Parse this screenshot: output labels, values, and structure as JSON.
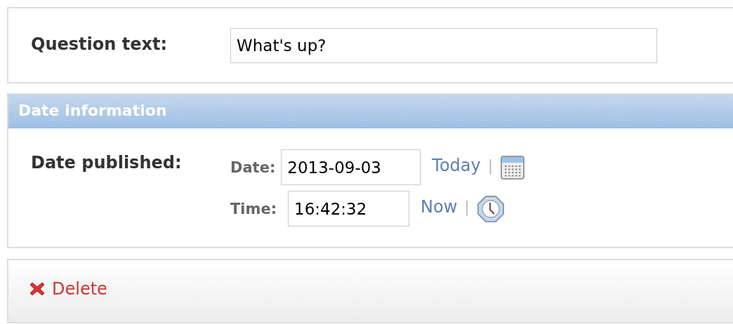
{
  "question": {
    "label": "Question text:",
    "value": "What's up?"
  },
  "date_section": {
    "title": "Date information",
    "label": "Date published:",
    "rows": [
      {
        "kind": "date",
        "label": "Date:",
        "value": "2013-09-03",
        "shortcut": "Today",
        "separator": "|"
      },
      {
        "kind": "time",
        "label": "Time:",
        "value": "16:42:32",
        "shortcut": "Now",
        "separator": "|"
      }
    ]
  },
  "delete_link": "Delete"
}
